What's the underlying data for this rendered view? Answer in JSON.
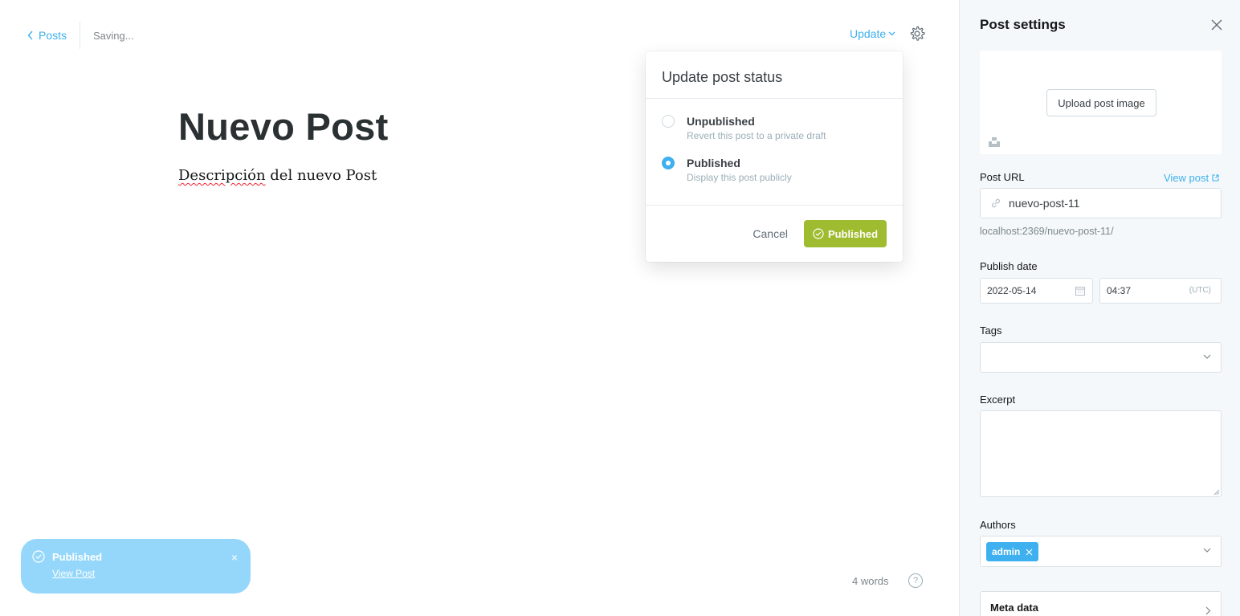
{
  "colors": {
    "accent": "#3eb0ef",
    "publish_green": "#9fbb2f",
    "toast_bg": "#95d7fb",
    "sidebar_bg": "#f4f8fb"
  },
  "editor": {
    "back_label": "Posts",
    "status": "Saving...",
    "update_label": "Update",
    "title": "Nuevo Post",
    "body_misspelled": "Descripción",
    "body_rest": " del nuevo Post",
    "word_count": "4 words",
    "help_label": "?"
  },
  "status_dropdown": {
    "header": "Update post status",
    "options": [
      {
        "title": "Unpublished",
        "description": "Revert this post to a private draft",
        "selected": false
      },
      {
        "title": "Published",
        "description": "Display this post publicly",
        "selected": true
      }
    ],
    "cancel_label": "Cancel",
    "confirm_label": "Published"
  },
  "toast": {
    "title": "Published",
    "link": "View Post",
    "close": "×"
  },
  "settings": {
    "title": "Post settings",
    "upload_label": "Upload post image",
    "post_url_label": "Post URL",
    "view_post_label": "View post",
    "slug": "nuevo-post-11",
    "url_hint": "localhost:2369/nuevo-post-11/",
    "publish_date_label": "Publish date",
    "date": "2022-05-14",
    "time": "04:37",
    "timezone": "(UTC)",
    "tags_label": "Tags",
    "excerpt_label": "Excerpt",
    "authors_label": "Authors",
    "authors": [
      "admin"
    ],
    "meta_label": "Meta data"
  },
  "icons": [
    "chevron-left-icon",
    "chevron-down-icon",
    "gear-icon",
    "check-circle-icon",
    "close-icon",
    "link-icon",
    "external-link-icon",
    "calendar-icon",
    "unsplash-icon",
    "chevron-right-icon",
    "help-icon"
  ]
}
